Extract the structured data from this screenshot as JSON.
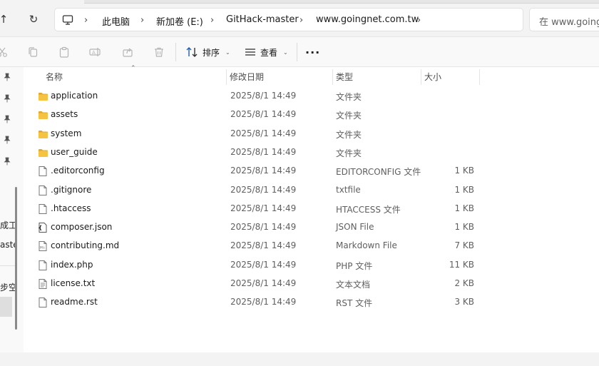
{
  "address": {
    "crumbs": [
      "此电脑",
      "新加卷 (E:)",
      "GitHack-master",
      "www.goingnet.com.tw"
    ],
    "separator": "›"
  },
  "search": {
    "placeholder": "在 www.goingnet.com.tw 中搜索"
  },
  "nav_buttons": {
    "up": "↑",
    "refresh": "↻"
  },
  "command_bar": {
    "sort_label": "排序",
    "view_label": "查看",
    "more_label": "···",
    "chevron": "⌄"
  },
  "nav_pane": {
    "snippets": [
      "成工",
      "aste",
      "步空"
    ]
  },
  "columns": {
    "name": "名称",
    "date": "修改日期",
    "type": "类型",
    "size": "大小"
  },
  "files": [
    {
      "name": "application",
      "date": "2025/8/1 14:49",
      "type": "文件夹",
      "size": "",
      "icon": "folder"
    },
    {
      "name": "assets",
      "date": "2025/8/1 14:49",
      "type": "文件夹",
      "size": "",
      "icon": "folder"
    },
    {
      "name": "system",
      "date": "2025/8/1 14:49",
      "type": "文件夹",
      "size": "",
      "icon": "folder"
    },
    {
      "name": "user_guide",
      "date": "2025/8/1 14:49",
      "type": "文件夹",
      "size": "",
      "icon": "folder"
    },
    {
      "name": ".editorconfig",
      "date": "2025/8/1 14:49",
      "type": "EDITORCONFIG 文件",
      "size": "1 KB",
      "icon": "file"
    },
    {
      "name": ".gitignore",
      "date": "2025/8/1 14:49",
      "type": "txtfile",
      "size": "1 KB",
      "icon": "file"
    },
    {
      "name": ".htaccess",
      "date": "2025/8/1 14:49",
      "type": "HTACCESS 文件",
      "size": "1 KB",
      "icon": "file"
    },
    {
      "name": "composer.json",
      "date": "2025/8/1 14:49",
      "type": "JSON File",
      "size": "1 KB",
      "icon": "json"
    },
    {
      "name": "contributing.md",
      "date": "2025/8/1 14:49",
      "type": "Markdown File",
      "size": "7 KB",
      "icon": "markdown"
    },
    {
      "name": "index.php",
      "date": "2025/8/1 14:49",
      "type": "PHP 文件",
      "size": "11 KB",
      "icon": "file"
    },
    {
      "name": "license.txt",
      "date": "2025/8/1 14:49",
      "type": "文本文档",
      "size": "2 KB",
      "icon": "text"
    },
    {
      "name": "readme.rst",
      "date": "2025/8/1 14:49",
      "type": "RST 文件",
      "size": "3 KB",
      "icon": "file"
    }
  ],
  "colors": {
    "folder": "#f5c242",
    "folder_dark": "#e0a82e",
    "accent": "#0067c0"
  }
}
